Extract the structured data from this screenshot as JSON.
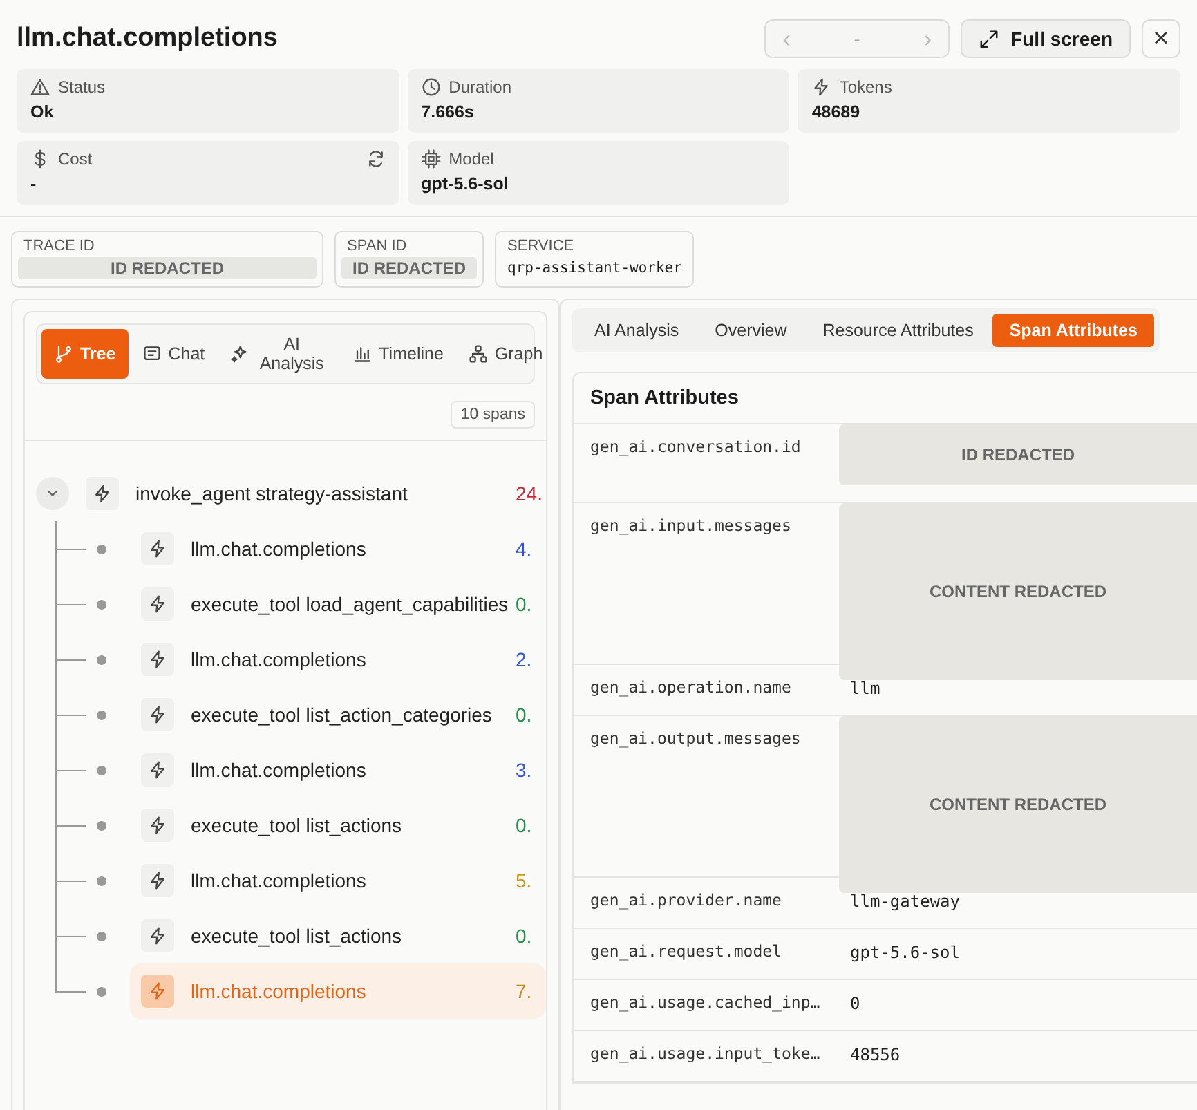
{
  "header": {
    "title": "llm.chat.completions",
    "pager": {
      "prev": "‹",
      "value": "-",
      "next": "›"
    },
    "fullscreen": "Full screen",
    "close": "×"
  },
  "stats": [
    {
      "label": "Status",
      "value": "Ok"
    },
    {
      "label": "Duration",
      "value": "7.666s"
    },
    {
      "label": "Tokens",
      "value": "48689"
    },
    {
      "label": "Cost",
      "value": "-"
    },
    {
      "label": "Model",
      "value": "gpt-5.6-sol"
    }
  ],
  "ids": [
    {
      "label": "TRACE ID",
      "value": "ID REDACTED",
      "kind": "redacted"
    },
    {
      "label": "SPAN ID",
      "value": "ID REDACTED",
      "kind": "redacted"
    },
    {
      "label": "SERVICE",
      "value": "qrp-assistant-worker",
      "kind": "text"
    }
  ],
  "view_tabs": [
    {
      "label": "Tree",
      "selected": true
    },
    {
      "label": "Chat",
      "selected": false
    },
    {
      "label": "AI Analysis",
      "selected": false
    },
    {
      "label": "Timeline",
      "selected": false
    },
    {
      "label": "Graph",
      "selected": false
    }
  ],
  "span_count": "10 spans",
  "tree": {
    "name": "invoke_agent strategy-assistant",
    "duration": "24.",
    "color": "#c8283c",
    "expanded": true,
    "selected": false,
    "children": [
      {
        "name": "llm.chat.completions",
        "duration": "4.",
        "color": "#2f55d4",
        "selected": false
      },
      {
        "name": "execute_tool load_agent_capabilities",
        "duration": "0.",
        "color": "#23904a",
        "selected": false
      },
      {
        "name": "llm.chat.completions",
        "duration": "2.",
        "color": "#2f55d4",
        "selected": false
      },
      {
        "name": "execute_tool list_action_categories",
        "duration": "0.",
        "color": "#23904a",
        "selected": false
      },
      {
        "name": "llm.chat.completions",
        "duration": "3.",
        "color": "#2f55d4",
        "selected": false
      },
      {
        "name": "execute_tool list_actions",
        "duration": "0.",
        "color": "#23904a",
        "selected": false
      },
      {
        "name": "llm.chat.completions",
        "duration": "5.",
        "color": "#c99a1c",
        "selected": false
      },
      {
        "name": "execute_tool list_actions",
        "duration": "0.",
        "color": "#23904a",
        "selected": false
      },
      {
        "name": "llm.chat.completions",
        "duration": "7.",
        "color": "#c98a1c",
        "selected": true
      }
    ]
  },
  "detail_tabs": [
    {
      "label": "AI Analysis",
      "selected": false
    },
    {
      "label": "Overview",
      "selected": false
    },
    {
      "label": "Resource Attributes",
      "selected": false
    },
    {
      "label": "Span Attributes",
      "selected": true
    }
  ],
  "attributes": {
    "title": "Span Attributes",
    "rows": [
      {
        "key": "gen_ai.conversation.id",
        "value": "ID REDACTED",
        "kind": "redacted_short"
      },
      {
        "key": "gen_ai.input.messages",
        "value": "CONTENT REDACTED",
        "kind": "redacted_tall"
      },
      {
        "key": "gen_ai.operation.name",
        "value": "llm",
        "kind": "text"
      },
      {
        "key": "gen_ai.output.messages",
        "value": "CONTENT REDACTED",
        "kind": "redacted_tall"
      },
      {
        "key": "gen_ai.provider.name",
        "value": "llm-gateway",
        "kind": "text"
      },
      {
        "key": "gen_ai.request.model",
        "value": "gpt-5.6-sol",
        "kind": "text"
      },
      {
        "key": "gen_ai.usage.cached_inp…",
        "value": "0",
        "kind": "text"
      },
      {
        "key": "gen_ai.usage.input_toke…",
        "value": "48556",
        "kind": "text"
      }
    ]
  }
}
